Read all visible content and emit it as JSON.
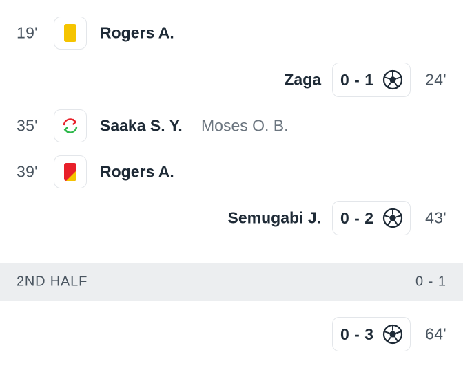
{
  "events": [
    {
      "minute": "19'",
      "icon": "yellow-card-icon",
      "player": "Rogers A."
    },
    {
      "minute": "24'",
      "icon": "football-icon",
      "player": "Zaga",
      "score": "0 - 1"
    },
    {
      "minute": "35'",
      "icon": "substitution-icon",
      "player": "Saaka S. Y.",
      "assist": "Moses O. B."
    },
    {
      "minute": "39'",
      "icon": "second-yellow-red-card-icon",
      "player": "Rogers A."
    },
    {
      "minute": "43'",
      "icon": "football-icon",
      "player": "Semugabi J.",
      "score": "0 - 2"
    },
    {
      "minute": "64'",
      "icon": "football-icon",
      "player": "",
      "score": "0 - 3"
    }
  ],
  "second_half": {
    "label": "2ND HALF",
    "score": "0 - 1"
  },
  "colors": {
    "yellow_card": "#f5c400",
    "red_card": "#e8202a",
    "sub_in": "#2db84a",
    "sub_out": "#e8202a",
    "divider_bg": "#eceef0"
  }
}
